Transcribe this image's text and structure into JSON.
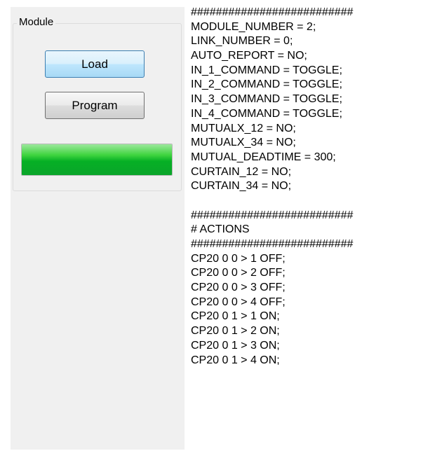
{
  "module_group": {
    "title": "Module",
    "load_label": "Load",
    "program_label": "Program",
    "progress_percent": 100,
    "progress_color": "#06b025"
  },
  "config_text": {
    "lines": [
      "##########################",
      "MODULE_NUMBER = 2;",
      "LINK_NUMBER = 0;",
      "AUTO_REPORT = NO;",
      "IN_1_COMMAND = TOGGLE;",
      "IN_2_COMMAND = TOGGLE;",
      "IN_3_COMMAND = TOGGLE;",
      "IN_4_COMMAND = TOGGLE;",
      "MUTUALX_12 = NO;",
      "MUTUALX_34 = NO;",
      "MUTUAL_DEADTIME = 300;",
      "CURTAIN_12 = NO;",
      "CURTAIN_34 = NO;",
      "",
      "##########################",
      "# ACTIONS",
      "##########################",
      "CP20 0 0 > 1 OFF;",
      "CP20 0 0 > 2 OFF;",
      "CP20 0 0 > 3 OFF;",
      "CP20 0 0 > 4 OFF;",
      "CP20 0 1 > 1 ON;",
      "CP20 0 1 > 2 ON;",
      "CP20 0 1 > 3 ON;",
      "CP20 0 1 > 4 ON;"
    ]
  }
}
